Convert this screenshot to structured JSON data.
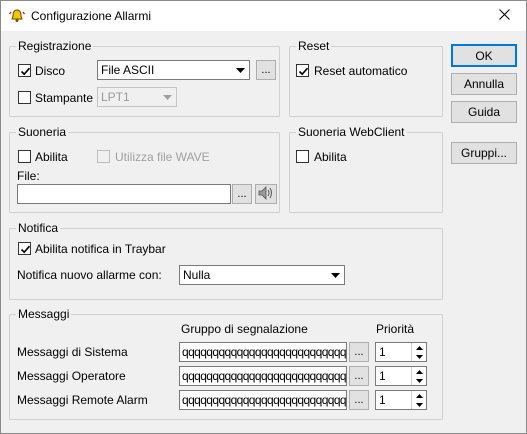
{
  "window": {
    "title": "Configurazione Allarmi"
  },
  "registrazione": {
    "legend": "Registrazione",
    "disco_label": "Disco",
    "disco_checked": true,
    "disco_format": "File ASCII",
    "browse_label": "...",
    "stampante_label": "Stampante",
    "stampante_checked": false,
    "stampante_port": "LPT1"
  },
  "reset": {
    "legend": "Reset",
    "auto_label": "Reset automatico",
    "auto_checked": true
  },
  "suoneria": {
    "legend": "Suoneria",
    "abilita_label": "Abilita",
    "abilita_checked": false,
    "wave_label": "Utilizza file WAVE",
    "file_label": "File:",
    "file_value": "",
    "browse_label": "..."
  },
  "suoneria_web": {
    "legend": "Suoneria WebClient",
    "abilita_label": "Abilita",
    "abilita_checked": false
  },
  "notifica": {
    "legend": "Notifica",
    "traybar_label": "Abilita notifica in Traybar",
    "traybar_checked": true,
    "nuovo_label": "Notifica nuovo allarme con:",
    "nuovo_value": "Nulla"
  },
  "messaggi": {
    "legend": "Messaggi",
    "col_gruppo": "Gruppo di segnalazione",
    "col_priorita": "Priorità",
    "rows": [
      {
        "label": "Messaggi di Sistema",
        "gruppo": "qqqqqqqqqqqqqqqqqqqqqqqqqqqqqqqqq",
        "browse": "...",
        "priorita": "1"
      },
      {
        "label": "Messaggi Operatore",
        "gruppo": "qqqqqqqqqqqqqqqqqqqqqqqqqqqqqqqqq",
        "browse": "...",
        "priorita": "1"
      },
      {
        "label": "Messaggi Remote Alarm",
        "gruppo": "qqqqqqqqqqqqqqqqqqqqqqqqqqqqqqqqq",
        "browse": "...",
        "priorita": "1"
      }
    ]
  },
  "buttons": {
    "ok": "OK",
    "annulla": "Annulla",
    "guida": "Guida",
    "gruppi": "Gruppi..."
  }
}
